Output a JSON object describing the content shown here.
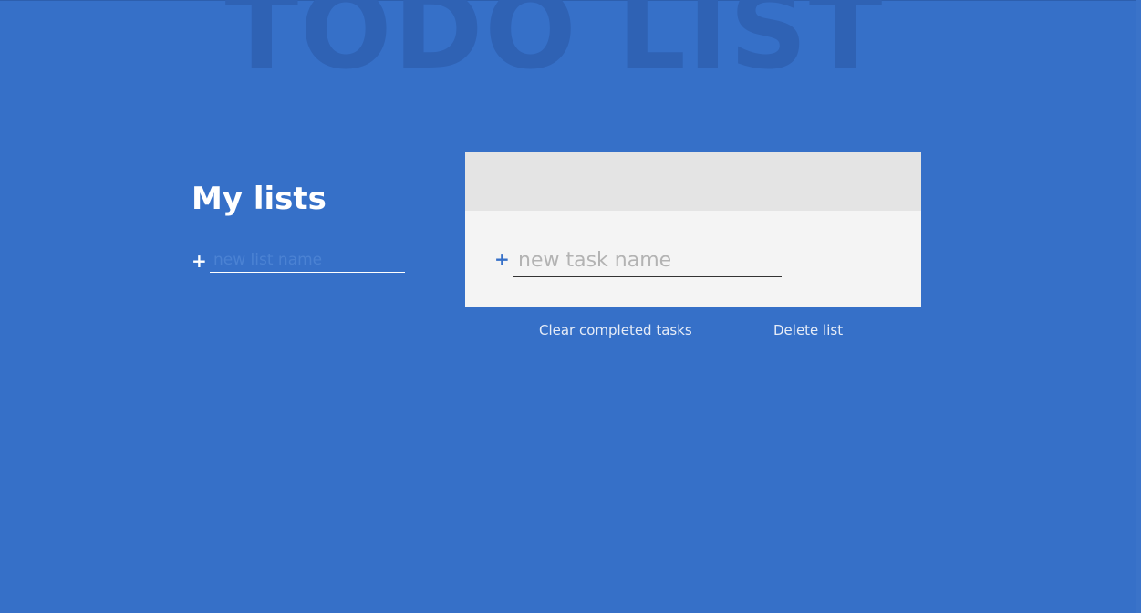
{
  "app": {
    "background_title": "TODO LIST"
  },
  "sidebar": {
    "title": "My lists",
    "add_icon": "plus-icon",
    "new_list_input": {
      "value": "",
      "placeholder": "new list name"
    }
  },
  "main": {
    "list_title": "",
    "add_icon": "plus-icon",
    "new_task_input": {
      "value": "",
      "placeholder": "new task name"
    },
    "actions": {
      "clear_label": "Clear completed tasks",
      "delete_label": "Delete list"
    }
  },
  "colors": {
    "background": "#3670c8",
    "card": "#f4f4f4",
    "card_header": "#e4e4e4",
    "accent": "#3670c8"
  }
}
